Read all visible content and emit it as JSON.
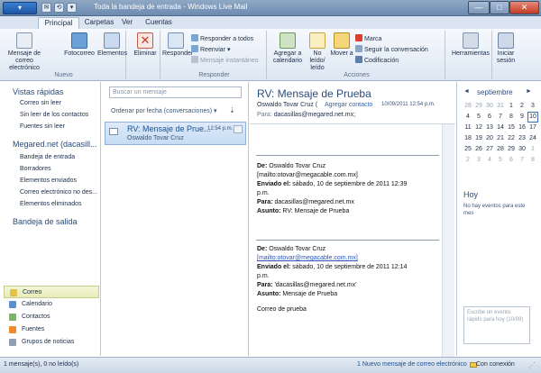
{
  "window": {
    "title": "Toda la bandeja de entrada - Windows Live Mail",
    "app_button": "▾",
    "controls": {
      "minimize": "—",
      "maximize": "□",
      "close": "✕"
    }
  },
  "quick_access": [
    "✉",
    "⟲",
    "▾"
  ],
  "tabs": [
    "Principal",
    "Carpetas",
    "Ver",
    "Cuentas"
  ],
  "ribbon": {
    "nuevo": {
      "label": "Nuevo",
      "correo": "Mensaje de correo electrónico",
      "foto": "Fotocorreo",
      "elementos": "Elementos"
    },
    "eliminar": {
      "label": "Eliminar"
    },
    "responder": {
      "label": "Responder",
      "responder": "Responder",
      "todos": "Responder a todos",
      "reenviar": "Reenviar",
      "instantaneo": "Mensaje instantáneo"
    },
    "acciones": {
      "label": "Acciones",
      "agregar": "Agregar a calendario",
      "noleido": "No leído/ leído",
      "mover": "Mover a",
      "marca": "Marca",
      "seguir": "Seguir la conversación",
      "codificacion": "Codificación"
    },
    "herramientas": "Herramientas",
    "iniciar": "Iniciar sesión"
  },
  "left": {
    "vistas_rapidas": "Vistas rápidas",
    "vistas_items": [
      "Correo sin leer",
      "Sin leer de los contactos",
      "Fuentes sin leer"
    ],
    "account": "Megared.net (dacasill...",
    "account_items": [
      "Bandeja de entrada",
      "Borradores",
      "Elementos enviados",
      "Correo electrónico no des...",
      "Elementos eliminados"
    ],
    "outbox": "Bandeja de salida",
    "nav": [
      "Correo",
      "Calendario",
      "Contactos",
      "Fuentes",
      "Grupos de noticias"
    ]
  },
  "list": {
    "search_placeholder": "Buscar un mensaje",
    "sort": "Ordenar por fecha (conversaciones) ▾",
    "message": {
      "subject": "RV: Mensaje de Prue...",
      "time": "12:54 p.m.",
      "from": "Oswaldo Tovar Cruz"
    }
  },
  "reading": {
    "title": "RV: Mensaje de Prueba",
    "sender": "Oswaldo Tovar Cruz  (",
    "add_contact": "Agregar contacto",
    "date": "10/09/2011 12:54 p.m.",
    "to_label": "Para:",
    "to_value": "dacasillas@megared.net.mx;",
    "block1": {
      "de_label": "De:",
      "de_value": "Oswaldo Tovar Cruz",
      "mailto": "[mailto:otovar@megacable.com.mx]",
      "enviado_label": "Enviado el:",
      "enviado_value": "sábado, 10 de septiembre de 2011 12:39",
      "enviado_pm": "p.m.",
      "para_label": "Para:",
      "para_value": "dacasillas@megared.net.mx",
      "asunto_label": "Asunto:",
      "asunto_value": "RV: Mensaje de Prueba"
    },
    "block2": {
      "de_label": "De:",
      "de_value": "Oswaldo Tovar Cruz",
      "mailto": "[mailto:otovar@megacable.com.mx]",
      "enviado_label": "Enviado el:",
      "enviado_value": "sábado, 10 de septiembre de 2011 12:14",
      "enviado_pm": "p.m.",
      "para_label": "Para:",
      "para_value": "'dacasillas@megared.net.mx'",
      "asunto_label": "Asunto:",
      "asunto_value": "Mensaje de Prueba"
    },
    "body_text": "Correo de prueba"
  },
  "calendar": {
    "month": "septiembre",
    "prev": "◄",
    "next": "►",
    "rows": [
      [
        "28",
        "29",
        "30",
        "31",
        "1",
        "2",
        "3"
      ],
      [
        "4",
        "5",
        "6",
        "7",
        "8",
        "9",
        "10"
      ],
      [
        "11",
        "12",
        "13",
        "14",
        "15",
        "16",
        "17"
      ],
      [
        "18",
        "19",
        "20",
        "21",
        "22",
        "23",
        "24"
      ],
      [
        "25",
        "26",
        "27",
        "28",
        "29",
        "30",
        "1"
      ],
      [
        "2",
        "3",
        "4",
        "5",
        "6",
        "7",
        "8"
      ]
    ],
    "hoy": "Hoy",
    "no_events": "No hay eventos para este mes",
    "quick_event": "Escribe un evento rápido para hoy (10/09)"
  },
  "status": {
    "left": "1 mensaje(s), 0 no leído(s)",
    "middle": "1 Nuevo mensaje de correo electrónico",
    "right": "Con conexión"
  },
  "colors": {
    "accent": "#2b4c7a",
    "link": "#2a64b5",
    "selection": "#c7dcf3"
  }
}
